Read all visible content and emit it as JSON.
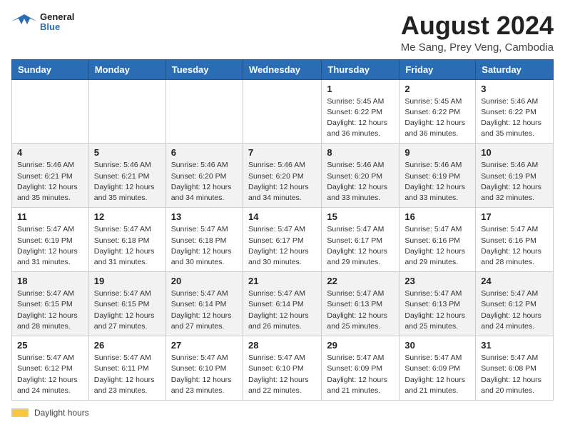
{
  "header": {
    "logo_line1": "General",
    "logo_line2": "Blue",
    "title": "August 2024",
    "subtitle": "Me Sang, Prey Veng, Cambodia"
  },
  "weekdays": [
    "Sunday",
    "Monday",
    "Tuesday",
    "Wednesday",
    "Thursday",
    "Friday",
    "Saturday"
  ],
  "weeks": [
    [
      {
        "day": "",
        "info": ""
      },
      {
        "day": "",
        "info": ""
      },
      {
        "day": "",
        "info": ""
      },
      {
        "day": "",
        "info": ""
      },
      {
        "day": "1",
        "info": "Sunrise: 5:45 AM\nSunset: 6:22 PM\nDaylight: 12 hours\nand 36 minutes."
      },
      {
        "day": "2",
        "info": "Sunrise: 5:45 AM\nSunset: 6:22 PM\nDaylight: 12 hours\nand 36 minutes."
      },
      {
        "day": "3",
        "info": "Sunrise: 5:46 AM\nSunset: 6:22 PM\nDaylight: 12 hours\nand 35 minutes."
      }
    ],
    [
      {
        "day": "4",
        "info": "Sunrise: 5:46 AM\nSunset: 6:21 PM\nDaylight: 12 hours\nand 35 minutes."
      },
      {
        "day": "5",
        "info": "Sunrise: 5:46 AM\nSunset: 6:21 PM\nDaylight: 12 hours\nand 35 minutes."
      },
      {
        "day": "6",
        "info": "Sunrise: 5:46 AM\nSunset: 6:20 PM\nDaylight: 12 hours\nand 34 minutes."
      },
      {
        "day": "7",
        "info": "Sunrise: 5:46 AM\nSunset: 6:20 PM\nDaylight: 12 hours\nand 34 minutes."
      },
      {
        "day": "8",
        "info": "Sunrise: 5:46 AM\nSunset: 6:20 PM\nDaylight: 12 hours\nand 33 minutes."
      },
      {
        "day": "9",
        "info": "Sunrise: 5:46 AM\nSunset: 6:19 PM\nDaylight: 12 hours\nand 33 minutes."
      },
      {
        "day": "10",
        "info": "Sunrise: 5:46 AM\nSunset: 6:19 PM\nDaylight: 12 hours\nand 32 minutes."
      }
    ],
    [
      {
        "day": "11",
        "info": "Sunrise: 5:47 AM\nSunset: 6:19 PM\nDaylight: 12 hours\nand 31 minutes."
      },
      {
        "day": "12",
        "info": "Sunrise: 5:47 AM\nSunset: 6:18 PM\nDaylight: 12 hours\nand 31 minutes."
      },
      {
        "day": "13",
        "info": "Sunrise: 5:47 AM\nSunset: 6:18 PM\nDaylight: 12 hours\nand 30 minutes."
      },
      {
        "day": "14",
        "info": "Sunrise: 5:47 AM\nSunset: 6:17 PM\nDaylight: 12 hours\nand 30 minutes."
      },
      {
        "day": "15",
        "info": "Sunrise: 5:47 AM\nSunset: 6:17 PM\nDaylight: 12 hours\nand 29 minutes."
      },
      {
        "day": "16",
        "info": "Sunrise: 5:47 AM\nSunset: 6:16 PM\nDaylight: 12 hours\nand 29 minutes."
      },
      {
        "day": "17",
        "info": "Sunrise: 5:47 AM\nSunset: 6:16 PM\nDaylight: 12 hours\nand 28 minutes."
      }
    ],
    [
      {
        "day": "18",
        "info": "Sunrise: 5:47 AM\nSunset: 6:15 PM\nDaylight: 12 hours\nand 28 minutes."
      },
      {
        "day": "19",
        "info": "Sunrise: 5:47 AM\nSunset: 6:15 PM\nDaylight: 12 hours\nand 27 minutes."
      },
      {
        "day": "20",
        "info": "Sunrise: 5:47 AM\nSunset: 6:14 PM\nDaylight: 12 hours\nand 27 minutes."
      },
      {
        "day": "21",
        "info": "Sunrise: 5:47 AM\nSunset: 6:14 PM\nDaylight: 12 hours\nand 26 minutes."
      },
      {
        "day": "22",
        "info": "Sunrise: 5:47 AM\nSunset: 6:13 PM\nDaylight: 12 hours\nand 25 minutes."
      },
      {
        "day": "23",
        "info": "Sunrise: 5:47 AM\nSunset: 6:13 PM\nDaylight: 12 hours\nand 25 minutes."
      },
      {
        "day": "24",
        "info": "Sunrise: 5:47 AM\nSunset: 6:12 PM\nDaylight: 12 hours\nand 24 minutes."
      }
    ],
    [
      {
        "day": "25",
        "info": "Sunrise: 5:47 AM\nSunset: 6:12 PM\nDaylight: 12 hours\nand 24 minutes."
      },
      {
        "day": "26",
        "info": "Sunrise: 5:47 AM\nSunset: 6:11 PM\nDaylight: 12 hours\nand 23 minutes."
      },
      {
        "day": "27",
        "info": "Sunrise: 5:47 AM\nSunset: 6:10 PM\nDaylight: 12 hours\nand 23 minutes."
      },
      {
        "day": "28",
        "info": "Sunrise: 5:47 AM\nSunset: 6:10 PM\nDaylight: 12 hours\nand 22 minutes."
      },
      {
        "day": "29",
        "info": "Sunrise: 5:47 AM\nSunset: 6:09 PM\nDaylight: 12 hours\nand 21 minutes."
      },
      {
        "day": "30",
        "info": "Sunrise: 5:47 AM\nSunset: 6:09 PM\nDaylight: 12 hours\nand 21 minutes."
      },
      {
        "day": "31",
        "info": "Sunrise: 5:47 AM\nSunset: 6:08 PM\nDaylight: 12 hours\nand 20 minutes."
      }
    ]
  ],
  "legend": {
    "label": "Daylight hours"
  }
}
